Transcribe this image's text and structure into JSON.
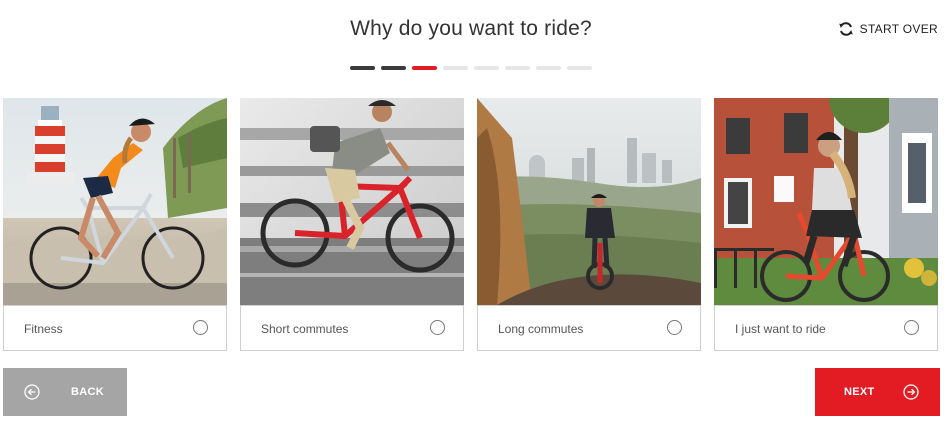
{
  "header": {
    "title": "Why do you want to ride?",
    "start_over_label": "START OVER",
    "start_over_icon": "refresh-icon"
  },
  "progress": {
    "total_steps": 8,
    "current_step": 3,
    "colors": {
      "done": "#3a3a3a",
      "active": "#e31b23",
      "pending": "#e6e6e6"
    }
  },
  "options": [
    {
      "label": "Fitness",
      "selected": false,
      "image": "cyclist-riding-on-beach-path-near-lighthouse"
    },
    {
      "label": "Short commutes",
      "selected": false,
      "image": "cyclist-commuting-past-blurred-railing"
    },
    {
      "label": "Long commutes",
      "selected": false,
      "image": "cyclist-on-hilltop-with-city-skyline"
    },
    {
      "label": "I just want to ride",
      "selected": false,
      "image": "cyclist-on-residential-street-with-brick-house"
    }
  ],
  "footer": {
    "back_label": "BACK",
    "back_icon": "arrow-left-circle-icon",
    "next_label": "NEXT",
    "next_icon": "arrow-right-circle-icon"
  },
  "colors": {
    "accent": "#e31b23",
    "back_button": "#a5a5a5"
  }
}
